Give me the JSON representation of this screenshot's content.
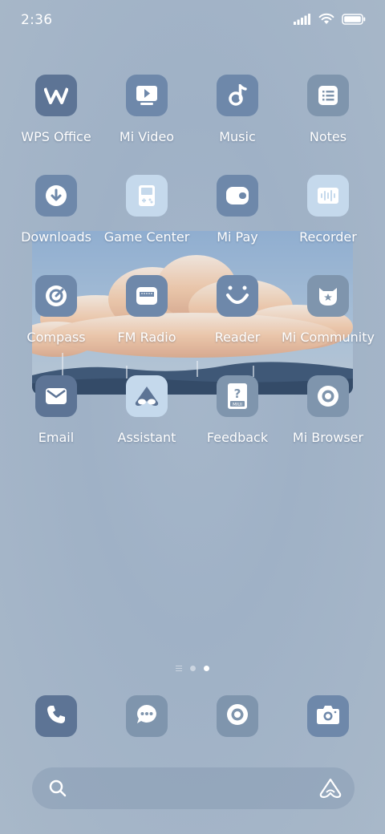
{
  "status": {
    "time": "2:36",
    "icons": [
      "signal-icon",
      "wifi-icon",
      "battery-icon"
    ]
  },
  "apps": [
    {
      "label": "WPS Office",
      "icon": "wps-office-icon"
    },
    {
      "label": "Mi Video",
      "icon": "mi-video-icon"
    },
    {
      "label": "Music",
      "icon": "music-icon"
    },
    {
      "label": "Notes",
      "icon": "notes-icon"
    },
    {
      "label": "Downloads",
      "icon": "downloads-icon"
    },
    {
      "label": "Game Center",
      "icon": "game-center-icon"
    },
    {
      "label": "Mi Pay",
      "icon": "mi-pay-icon"
    },
    {
      "label": "Recorder",
      "icon": "recorder-icon"
    },
    {
      "label": "Compass",
      "icon": "compass-icon"
    },
    {
      "label": "FM Radio",
      "icon": "fm-radio-icon"
    },
    {
      "label": "Reader",
      "icon": "reader-icon"
    },
    {
      "label": "Mi Community",
      "icon": "mi-community-icon"
    },
    {
      "label": "Email",
      "icon": "email-icon"
    },
    {
      "label": "Assistant",
      "icon": "assistant-icon"
    },
    {
      "label": "Feedback",
      "icon": "feedback-icon",
      "badge_text": "MIUI"
    },
    {
      "label": "Mi Browser",
      "icon": "mi-browser-icon"
    }
  ],
  "page_indicator": {
    "pages": 2,
    "active_page": 2
  },
  "dock": [
    {
      "icon": "phone-icon"
    },
    {
      "icon": "messaging-icon"
    },
    {
      "icon": "browser-icon"
    },
    {
      "icon": "camera-icon"
    }
  ],
  "colors": {
    "icon_dark": "#5d7495",
    "icon_mid": "#6e88aa",
    "icon_light": "#c5d9ec",
    "background": "#a6b7ca"
  }
}
